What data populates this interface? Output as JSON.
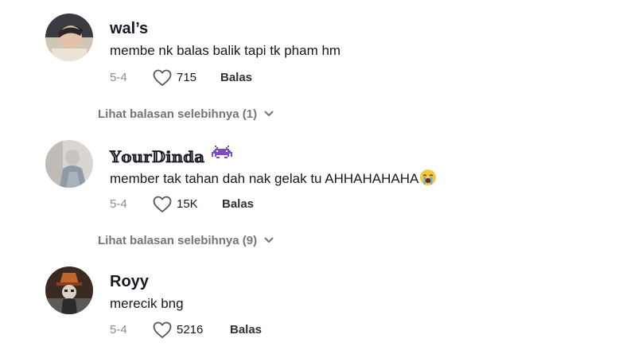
{
  "comments": [
    {
      "username": "wal’s",
      "text": "membe nk balas balik tapi tk pham hm",
      "date": "5-4",
      "likes": "715",
      "reply_label": "Balas",
      "view_replies": "Lihat balasan selebihnya (1)"
    },
    {
      "username": "𝕐𝕠𝕦𝕣𝔻𝕚𝕟𝕕𝕒",
      "username_badge_icon": "alien-monster-emoji-icon",
      "text": "member tak tahan dah nak gelak tu AHHAHAHAHA",
      "text_emoji_icon": "crying-face-emoji-icon",
      "date": "5-4",
      "likes": "15K",
      "reply_label": "Balas",
      "view_replies": "Lihat balasan selebihnya (9)"
    },
    {
      "username": "Royy",
      "text": "merecik bng",
      "date": "5-4",
      "likes": "5216",
      "reply_label": "Balas"
    }
  ],
  "colors": {
    "text": "#161823",
    "muted": "#8a8b91",
    "view_replies": "#73747b",
    "background": "#ffffff"
  }
}
